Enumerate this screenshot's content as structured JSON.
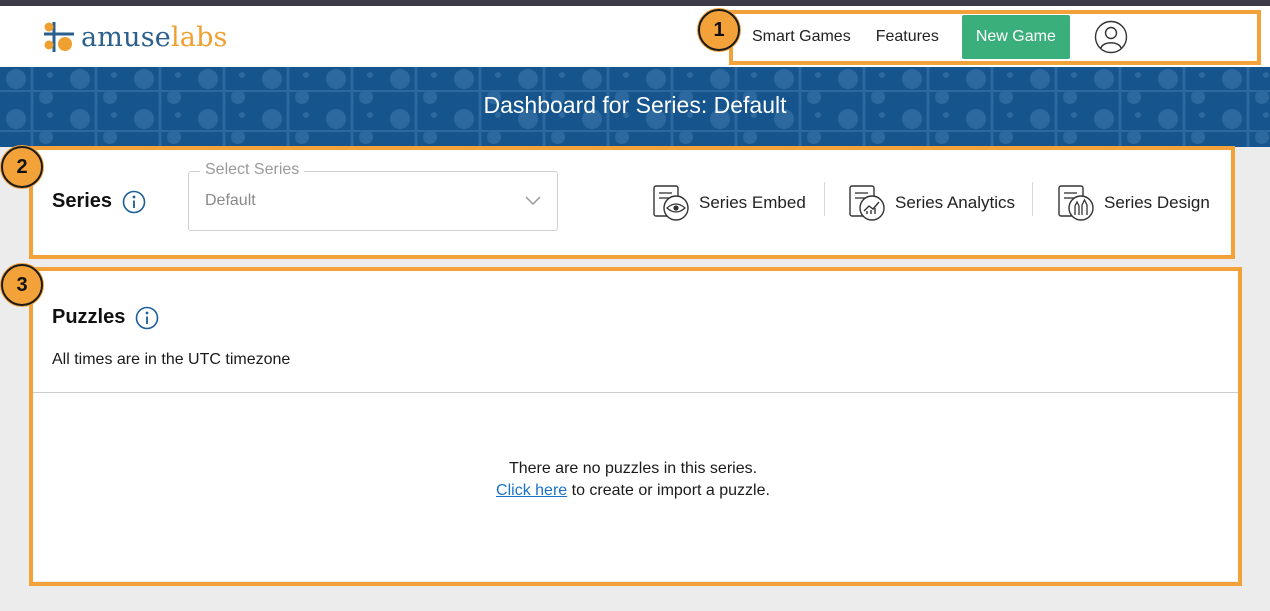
{
  "brand": {
    "logo_part1": "amuse",
    "logo_part2": "labs"
  },
  "nav": {
    "smart_games": "Smart Games",
    "features": "Features",
    "new_game": "New Game"
  },
  "banner": {
    "title": "Dashboard for Series: Default"
  },
  "series": {
    "title": "Series",
    "select_label": "Select Series",
    "select_value": "Default",
    "tools": {
      "embed": "Series Embed",
      "analytics": "Series Analytics",
      "design": "Series Design"
    }
  },
  "puzzles": {
    "title": "Puzzles",
    "timezone_note": "All times are in the UTC timezone",
    "empty_message": "There are no puzzles in this series.",
    "create_link": "Click here",
    "create_suffix": " to create or import a puzzle."
  },
  "annotations": {
    "badge1": "1",
    "badge2": "2",
    "badge3": "3"
  },
  "colors": {
    "accent_orange": "#f3a23a",
    "banner_blue": "#16548e",
    "new_game_green": "#3aae7b",
    "logo_blue": "#2b5f8c"
  }
}
